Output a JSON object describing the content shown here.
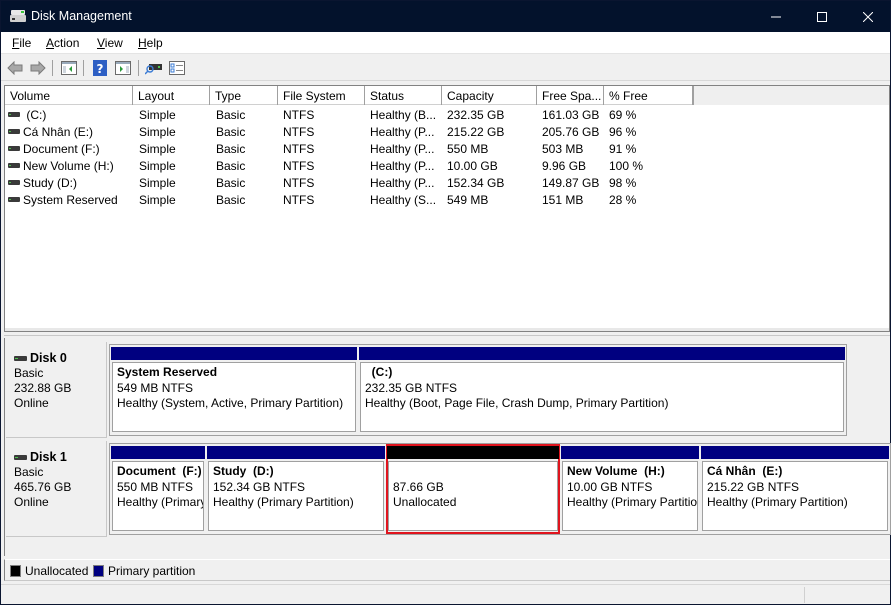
{
  "window": {
    "title": "Disk Management",
    "controls": {
      "minimize": "—",
      "maximize": "☐",
      "close": "✕"
    }
  },
  "menu": [
    {
      "label": "File",
      "mnemonic": "F",
      "rest": "ile"
    },
    {
      "label": "Action",
      "mnemonic": "A",
      "rest": "ction"
    },
    {
      "label": "View",
      "mnemonic": "V",
      "rest": "iew"
    },
    {
      "label": "Help",
      "mnemonic": "H",
      "rest": "elp"
    }
  ],
  "toolbar": [
    {
      "icon": "back-arrow-icon"
    },
    {
      "icon": "forward-arrow-icon"
    },
    {
      "icon": "show-hide-console-tree-icon"
    },
    {
      "icon": "help-icon",
      "glyph": "?"
    },
    {
      "icon": "show-action-pane-icon"
    },
    {
      "icon": "connect-drive-icon"
    },
    {
      "icon": "properties-checklist-icon"
    }
  ],
  "volume_list": {
    "columns": [
      "Volume",
      "Layout",
      "Type",
      "File System",
      "Status",
      "Capacity",
      "Free Spa...",
      "% Free"
    ],
    "rows": [
      {
        "volume": " (C:)",
        "layout": "Simple",
        "type": "Basic",
        "fs": "NTFS",
        "status": "Healthy (B...",
        "capacity": "232.35 GB",
        "free": "161.03 GB",
        "pct": "69 %"
      },
      {
        "volume": "Cá Nhân (E:)",
        "layout": "Simple",
        "type": "Basic",
        "fs": "NTFS",
        "status": "Healthy (P...",
        "capacity": "215.22 GB",
        "free": "205.76 GB",
        "pct": "96 %"
      },
      {
        "volume": "Document (F:)",
        "layout": "Simple",
        "type": "Basic",
        "fs": "NTFS",
        "status": "Healthy (P...",
        "capacity": "550 MB",
        "free": "503 MB",
        "pct": "91 %"
      },
      {
        "volume": "New Volume (H:)",
        "layout": "Simple",
        "type": "Basic",
        "fs": "NTFS",
        "status": "Healthy (P...",
        "capacity": "10.00 GB",
        "free": "9.96 GB",
        "pct": "100 %"
      },
      {
        "volume": "Study (D:)",
        "layout": "Simple",
        "type": "Basic",
        "fs": "NTFS",
        "status": "Healthy (P...",
        "capacity": "152.34 GB",
        "free": "149.87 GB",
        "pct": "98 %"
      },
      {
        "volume": "System Reserved",
        "layout": "Simple",
        "type": "Basic",
        "fs": "NTFS",
        "status": "Healthy (S...",
        "capacity": "549 MB",
        "free": "151 MB",
        "pct": "28 %"
      }
    ]
  },
  "disks": [
    {
      "name": "Disk 0",
      "type": "Basic",
      "size": "232.88 GB",
      "state": "Online",
      "partitions": [
        {
          "name": "System Reserved",
          "size": "549 MB NTFS",
          "status": "Healthy (System, Active, Primary Partition)",
          "kind": "primary"
        },
        {
          "name": "  (C:)",
          "size": "232.35 GB NTFS",
          "status": "Healthy (Boot, Page File, Crash Dump, Primary Partition)",
          "kind": "primary"
        }
      ]
    },
    {
      "name": "Disk 1",
      "type": "Basic",
      "size": "465.76 GB",
      "state": "Online",
      "partitions": [
        {
          "name": "Document  (F:)",
          "size": "550 MB NTFS",
          "status": "Healthy (Primary Partition)",
          "kind": "primary"
        },
        {
          "name": "Study  (D:)",
          "size": "152.34 GB NTFS",
          "status": "Healthy (Primary Partition)",
          "kind": "primary"
        },
        {
          "name": "",
          "size": "87.66 GB",
          "status": "Unallocated",
          "kind": "unallocated",
          "selected": true
        },
        {
          "name": "New Volume  (H:)",
          "size": "10.00 GB NTFS",
          "status": "Healthy (Primary Partition)",
          "kind": "primary"
        },
        {
          "name": "Cá Nhân  (E:)",
          "size": "215.22 GB NTFS",
          "status": "Healthy (Primary Partition)",
          "kind": "primary"
        }
      ]
    }
  ],
  "legend": [
    {
      "label": "Unallocated",
      "color": "#000000"
    },
    {
      "label": "Primary partition",
      "color": "#000080"
    }
  ],
  "colors": {
    "titlebar": "#03122c",
    "primary": "#000080",
    "unallocated": "#000000",
    "selection": "#e0141e"
  }
}
